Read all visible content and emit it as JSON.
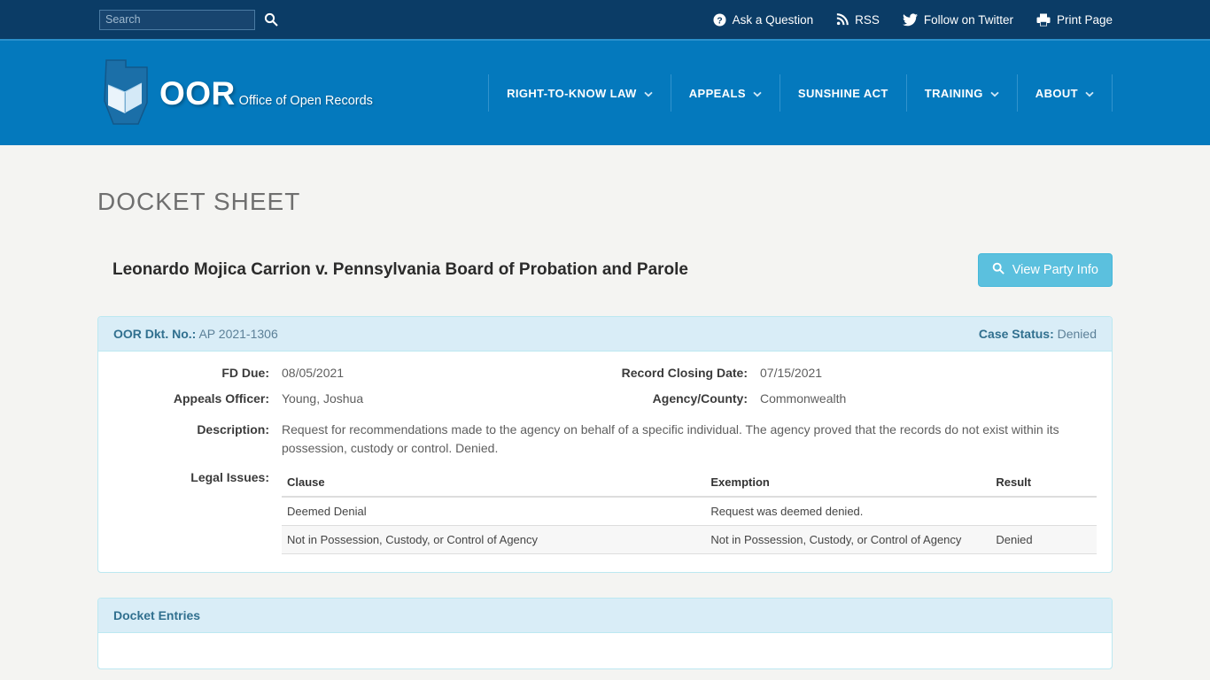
{
  "utility": {
    "search_placeholder": "Search",
    "search_value": "",
    "search_button_label": "Search",
    "links": [
      {
        "label": "Ask a Question",
        "icon": "question-circle-icon"
      },
      {
        "label": "RSS",
        "icon": "rss-icon"
      },
      {
        "label": "Follow on Twitter",
        "icon": "twitter-icon"
      },
      {
        "label": "Print Page",
        "icon": "printer-icon"
      }
    ]
  },
  "brand": {
    "title": "OOR",
    "subtitle": "Office of Open Records"
  },
  "nav": {
    "items": [
      {
        "label": "RIGHT-TO-KNOW LAW",
        "has_caret": true
      },
      {
        "label": "APPEALS",
        "has_caret": true
      },
      {
        "label": "SUNSHINE ACT",
        "has_caret": false
      },
      {
        "label": "TRAINING",
        "has_caret": true
      },
      {
        "label": "ABOUT",
        "has_caret": true
      }
    ]
  },
  "page": {
    "title": "DOCKET SHEET",
    "case_title": "Leonardo Mojica Carrion v. Pennsylvania Board of Probation and Parole",
    "party_button_label": "View Party Info"
  },
  "docket": {
    "dkt_label": "OOR Dkt. No.:",
    "dkt_value": "AP 2021-1306",
    "status_label": "Case Status:",
    "status_value": "Denied",
    "fields": {
      "fd_due_label": "FD Due:",
      "fd_due_value": "08/05/2021",
      "record_closing_label": "Record Closing Date:",
      "record_closing_value": "07/15/2021",
      "appeals_officer_label": "Appeals Officer:",
      "appeals_officer_value": "Young, Joshua",
      "agency_label": "Agency/County:",
      "agency_value": "Commonwealth",
      "description_label": "Description:",
      "description_value": "Request for recommendations made to the agency on behalf of a specific individual. The agency proved that the records do not exist within its possession, custody or control. Denied.",
      "legal_issues_label": "Legal Issues:"
    },
    "legal_issues": {
      "columns": [
        "Clause",
        "Exemption",
        "Result"
      ],
      "rows": [
        [
          "Deemed Denial",
          "Request was deemed denied.",
          ""
        ],
        [
          "Not in Possession, Custody, or Control of Agency",
          "Not in Possession, Custody, or Control of Agency",
          "Denied"
        ]
      ]
    }
  },
  "entries": {
    "title": "Docket Entries"
  },
  "colors": {
    "topbar": "#0b3c66",
    "header_blue": "#0479bd",
    "panel_head": "#d9edf7",
    "panel_border": "#bce8f1",
    "accent_button": "#5bc0de",
    "page_bg": "#f4f4f2"
  }
}
